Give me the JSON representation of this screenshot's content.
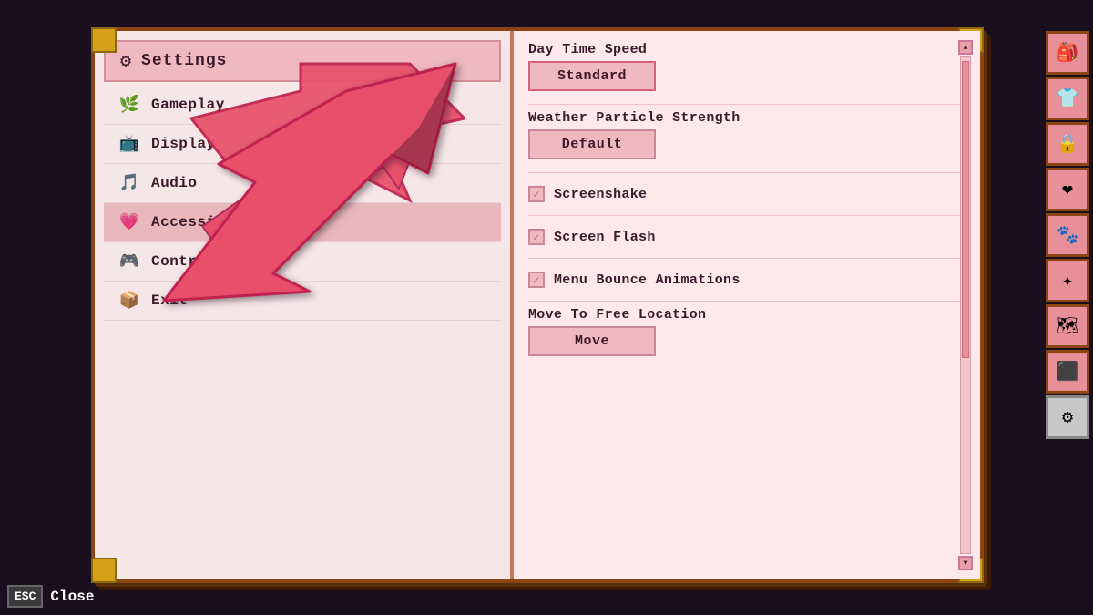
{
  "title": "Settings",
  "header": {
    "title": "Settings",
    "gear_icon": "⚙"
  },
  "menu": {
    "items": [
      {
        "id": "gameplay",
        "label": "Gameplay",
        "icon": "🌿",
        "active": false
      },
      {
        "id": "display",
        "label": "Display",
        "icon": "📺",
        "active": false
      },
      {
        "id": "audio",
        "label": "Audio",
        "icon": "🎵",
        "active": false
      },
      {
        "id": "accessibility",
        "label": "Accessibility",
        "icon": "💗",
        "active": true
      },
      {
        "id": "controls",
        "label": "Controls",
        "icon": "🎮",
        "active": false
      },
      {
        "id": "exit",
        "label": "Exit",
        "icon": "📦",
        "active": false
      }
    ]
  },
  "settings": {
    "sections": [
      {
        "id": "day-time-speed",
        "label": "Day Time Speed",
        "type": "button",
        "value": "Standard",
        "highlighted": true
      },
      {
        "id": "weather-particle-strength",
        "label": "Weather Particle Strength",
        "type": "button",
        "value": "Default",
        "highlighted": false
      },
      {
        "id": "screenshake",
        "label": "Screenshake",
        "type": "checkbox",
        "checked": true
      },
      {
        "id": "screen-flash",
        "label": "Screen Flash",
        "type": "checkbox",
        "checked": true
      },
      {
        "id": "menu-bounce-animations",
        "label": "Menu Bounce Animations",
        "type": "checkbox",
        "checked": true
      },
      {
        "id": "move-to-free-location",
        "label": "Move To Free Location",
        "type": "button",
        "value": "Move",
        "highlighted": false
      }
    ]
  },
  "sidebar_icons": [
    "🎒",
    "👕",
    "🔒",
    "❤",
    "🐾",
    "✦",
    "🗺",
    "⬛",
    "⚙"
  ],
  "esc": {
    "key": "ESC",
    "label": "Close"
  },
  "colors": {
    "accent": "#e8506a",
    "background": "#1a0f1e",
    "book_spine": "#c8785a",
    "page_left": "#f5e6e8",
    "page_right": "#fde8ec",
    "button_bg": "#f0b8c0",
    "active_item": "#e8b8bc"
  }
}
